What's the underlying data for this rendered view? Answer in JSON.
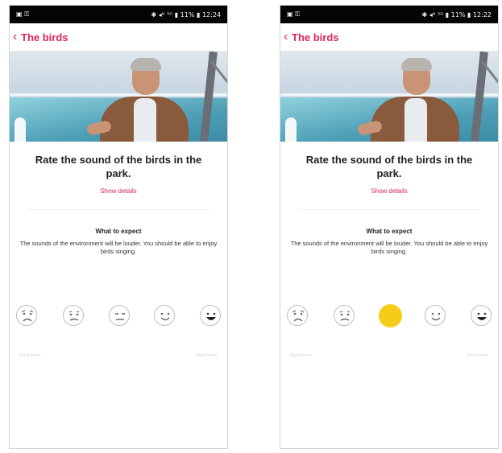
{
  "screens": [
    {
      "status": {
        "left": "▣ ⚿",
        "right": "✱ ◂ᴺ ⁵ᴳ ▮ 11% ▮ 12:24"
      },
      "nav": {
        "back_label": "‹",
        "title": "The birds"
      },
      "question": "Rate the sound of the birds in the park.",
      "show_details": "Show details",
      "expect_title": "What to expect",
      "expect_text": "The sounds of the environment will be louder. You should be able to enjoy birds singing.",
      "faces": [
        {
          "icon": "very-sad-face-icon",
          "selected": false
        },
        {
          "icon": "sad-face-icon",
          "selected": false
        },
        {
          "icon": "neutral-face-icon",
          "selected": false
        },
        {
          "icon": "smile-face-icon",
          "selected": false
        },
        {
          "icon": "laugh-face-icon",
          "selected": false
        }
      ],
      "scale_left": "Much worse",
      "scale_right": "Much better"
    },
    {
      "status": {
        "left": "▣ ⚿",
        "right": "✱ ◂ᴺ ⁵ᴳ ▮ 11% ▮ 12:22"
      },
      "nav": {
        "back_label": "‹",
        "title": "The birds"
      },
      "question": "Rate the sound of the birds in the park.",
      "show_details": "Show details",
      "expect_title": "What to expect",
      "expect_text": "The sounds of the environment will be louder. You should be able to enjoy birds singing.",
      "faces": [
        {
          "icon": "very-sad-face-icon",
          "selected": false
        },
        {
          "icon": "sad-face-icon",
          "selected": false
        },
        {
          "icon": "neutral-face-icon",
          "selected": true
        },
        {
          "icon": "smile-face-icon",
          "selected": false
        },
        {
          "icon": "laugh-face-icon",
          "selected": false
        }
      ],
      "scale_left": "Much worse",
      "scale_right": "Much better"
    }
  ],
  "colors": {
    "accent": "#e0245e",
    "selected_face": "#f7cc18",
    "face_border": "#bdbdbd"
  }
}
